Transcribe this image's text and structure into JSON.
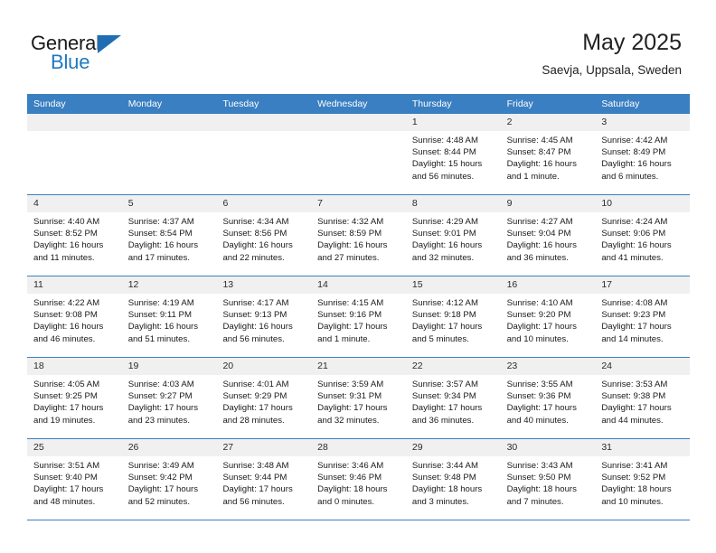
{
  "brand": {
    "name_top": "General",
    "name_bottom": "Blue",
    "triangle_color": "#1f6eb4",
    "text_color_top": "#1a1a1a",
    "text_color_bottom": "#1f7ac0"
  },
  "header": {
    "title": "May 2025",
    "subtitle": "Saevja, Uppsala, Sweden"
  },
  "theme": {
    "header_blue": "#3a7fc1",
    "day_band_gray": "#f0f0f0",
    "text_black": "#1a1a1a"
  },
  "weekdays": [
    "Sunday",
    "Monday",
    "Tuesday",
    "Wednesday",
    "Thursday",
    "Friday",
    "Saturday"
  ],
  "weeks": [
    [
      {
        "day": "",
        "sunrise": "",
        "sunset": "",
        "daylight_line1": "",
        "daylight_line2": ""
      },
      {
        "day": "",
        "sunrise": "",
        "sunset": "",
        "daylight_line1": "",
        "daylight_line2": ""
      },
      {
        "day": "",
        "sunrise": "",
        "sunset": "",
        "daylight_line1": "",
        "daylight_line2": ""
      },
      {
        "day": "",
        "sunrise": "",
        "sunset": "",
        "daylight_line1": "",
        "daylight_line2": ""
      },
      {
        "day": "1",
        "sunrise": "Sunrise: 4:48 AM",
        "sunset": "Sunset: 8:44 PM",
        "daylight_line1": "Daylight: 15 hours",
        "daylight_line2": "and 56 minutes."
      },
      {
        "day": "2",
        "sunrise": "Sunrise: 4:45 AM",
        "sunset": "Sunset: 8:47 PM",
        "daylight_line1": "Daylight: 16 hours",
        "daylight_line2": "and 1 minute."
      },
      {
        "day": "3",
        "sunrise": "Sunrise: 4:42 AM",
        "sunset": "Sunset: 8:49 PM",
        "daylight_line1": "Daylight: 16 hours",
        "daylight_line2": "and 6 minutes."
      }
    ],
    [
      {
        "day": "4",
        "sunrise": "Sunrise: 4:40 AM",
        "sunset": "Sunset: 8:52 PM",
        "daylight_line1": "Daylight: 16 hours",
        "daylight_line2": "and 11 minutes."
      },
      {
        "day": "5",
        "sunrise": "Sunrise: 4:37 AM",
        "sunset": "Sunset: 8:54 PM",
        "daylight_line1": "Daylight: 16 hours",
        "daylight_line2": "and 17 minutes."
      },
      {
        "day": "6",
        "sunrise": "Sunrise: 4:34 AM",
        "sunset": "Sunset: 8:56 PM",
        "daylight_line1": "Daylight: 16 hours",
        "daylight_line2": "and 22 minutes."
      },
      {
        "day": "7",
        "sunrise": "Sunrise: 4:32 AM",
        "sunset": "Sunset: 8:59 PM",
        "daylight_line1": "Daylight: 16 hours",
        "daylight_line2": "and 27 minutes."
      },
      {
        "day": "8",
        "sunrise": "Sunrise: 4:29 AM",
        "sunset": "Sunset: 9:01 PM",
        "daylight_line1": "Daylight: 16 hours",
        "daylight_line2": "and 32 minutes."
      },
      {
        "day": "9",
        "sunrise": "Sunrise: 4:27 AM",
        "sunset": "Sunset: 9:04 PM",
        "daylight_line1": "Daylight: 16 hours",
        "daylight_line2": "and 36 minutes."
      },
      {
        "day": "10",
        "sunrise": "Sunrise: 4:24 AM",
        "sunset": "Sunset: 9:06 PM",
        "daylight_line1": "Daylight: 16 hours",
        "daylight_line2": "and 41 minutes."
      }
    ],
    [
      {
        "day": "11",
        "sunrise": "Sunrise: 4:22 AM",
        "sunset": "Sunset: 9:08 PM",
        "daylight_line1": "Daylight: 16 hours",
        "daylight_line2": "and 46 minutes."
      },
      {
        "day": "12",
        "sunrise": "Sunrise: 4:19 AM",
        "sunset": "Sunset: 9:11 PM",
        "daylight_line1": "Daylight: 16 hours",
        "daylight_line2": "and 51 minutes."
      },
      {
        "day": "13",
        "sunrise": "Sunrise: 4:17 AM",
        "sunset": "Sunset: 9:13 PM",
        "daylight_line1": "Daylight: 16 hours",
        "daylight_line2": "and 56 minutes."
      },
      {
        "day": "14",
        "sunrise": "Sunrise: 4:15 AM",
        "sunset": "Sunset: 9:16 PM",
        "daylight_line1": "Daylight: 17 hours",
        "daylight_line2": "and 1 minute."
      },
      {
        "day": "15",
        "sunrise": "Sunrise: 4:12 AM",
        "sunset": "Sunset: 9:18 PM",
        "daylight_line1": "Daylight: 17 hours",
        "daylight_line2": "and 5 minutes."
      },
      {
        "day": "16",
        "sunrise": "Sunrise: 4:10 AM",
        "sunset": "Sunset: 9:20 PM",
        "daylight_line1": "Daylight: 17 hours",
        "daylight_line2": "and 10 minutes."
      },
      {
        "day": "17",
        "sunrise": "Sunrise: 4:08 AM",
        "sunset": "Sunset: 9:23 PM",
        "daylight_line1": "Daylight: 17 hours",
        "daylight_line2": "and 14 minutes."
      }
    ],
    [
      {
        "day": "18",
        "sunrise": "Sunrise: 4:05 AM",
        "sunset": "Sunset: 9:25 PM",
        "daylight_line1": "Daylight: 17 hours",
        "daylight_line2": "and 19 minutes."
      },
      {
        "day": "19",
        "sunrise": "Sunrise: 4:03 AM",
        "sunset": "Sunset: 9:27 PM",
        "daylight_line1": "Daylight: 17 hours",
        "daylight_line2": "and 23 minutes."
      },
      {
        "day": "20",
        "sunrise": "Sunrise: 4:01 AM",
        "sunset": "Sunset: 9:29 PM",
        "daylight_line1": "Daylight: 17 hours",
        "daylight_line2": "and 28 minutes."
      },
      {
        "day": "21",
        "sunrise": "Sunrise: 3:59 AM",
        "sunset": "Sunset: 9:31 PM",
        "daylight_line1": "Daylight: 17 hours",
        "daylight_line2": "and 32 minutes."
      },
      {
        "day": "22",
        "sunrise": "Sunrise: 3:57 AM",
        "sunset": "Sunset: 9:34 PM",
        "daylight_line1": "Daylight: 17 hours",
        "daylight_line2": "and 36 minutes."
      },
      {
        "day": "23",
        "sunrise": "Sunrise: 3:55 AM",
        "sunset": "Sunset: 9:36 PM",
        "daylight_line1": "Daylight: 17 hours",
        "daylight_line2": "and 40 minutes."
      },
      {
        "day": "24",
        "sunrise": "Sunrise: 3:53 AM",
        "sunset": "Sunset: 9:38 PM",
        "daylight_line1": "Daylight: 17 hours",
        "daylight_line2": "and 44 minutes."
      }
    ],
    [
      {
        "day": "25",
        "sunrise": "Sunrise: 3:51 AM",
        "sunset": "Sunset: 9:40 PM",
        "daylight_line1": "Daylight: 17 hours",
        "daylight_line2": "and 48 minutes."
      },
      {
        "day": "26",
        "sunrise": "Sunrise: 3:49 AM",
        "sunset": "Sunset: 9:42 PM",
        "daylight_line1": "Daylight: 17 hours",
        "daylight_line2": "and 52 minutes."
      },
      {
        "day": "27",
        "sunrise": "Sunrise: 3:48 AM",
        "sunset": "Sunset: 9:44 PM",
        "daylight_line1": "Daylight: 17 hours",
        "daylight_line2": "and 56 minutes."
      },
      {
        "day": "28",
        "sunrise": "Sunrise: 3:46 AM",
        "sunset": "Sunset: 9:46 PM",
        "daylight_line1": "Daylight: 18 hours",
        "daylight_line2": "and 0 minutes."
      },
      {
        "day": "29",
        "sunrise": "Sunrise: 3:44 AM",
        "sunset": "Sunset: 9:48 PM",
        "daylight_line1": "Daylight: 18 hours",
        "daylight_line2": "and 3 minutes."
      },
      {
        "day": "30",
        "sunrise": "Sunrise: 3:43 AM",
        "sunset": "Sunset: 9:50 PM",
        "daylight_line1": "Daylight: 18 hours",
        "daylight_line2": "and 7 minutes."
      },
      {
        "day": "31",
        "sunrise": "Sunrise: 3:41 AM",
        "sunset": "Sunset: 9:52 PM",
        "daylight_line1": "Daylight: 18 hours",
        "daylight_line2": "and 10 minutes."
      }
    ]
  ]
}
